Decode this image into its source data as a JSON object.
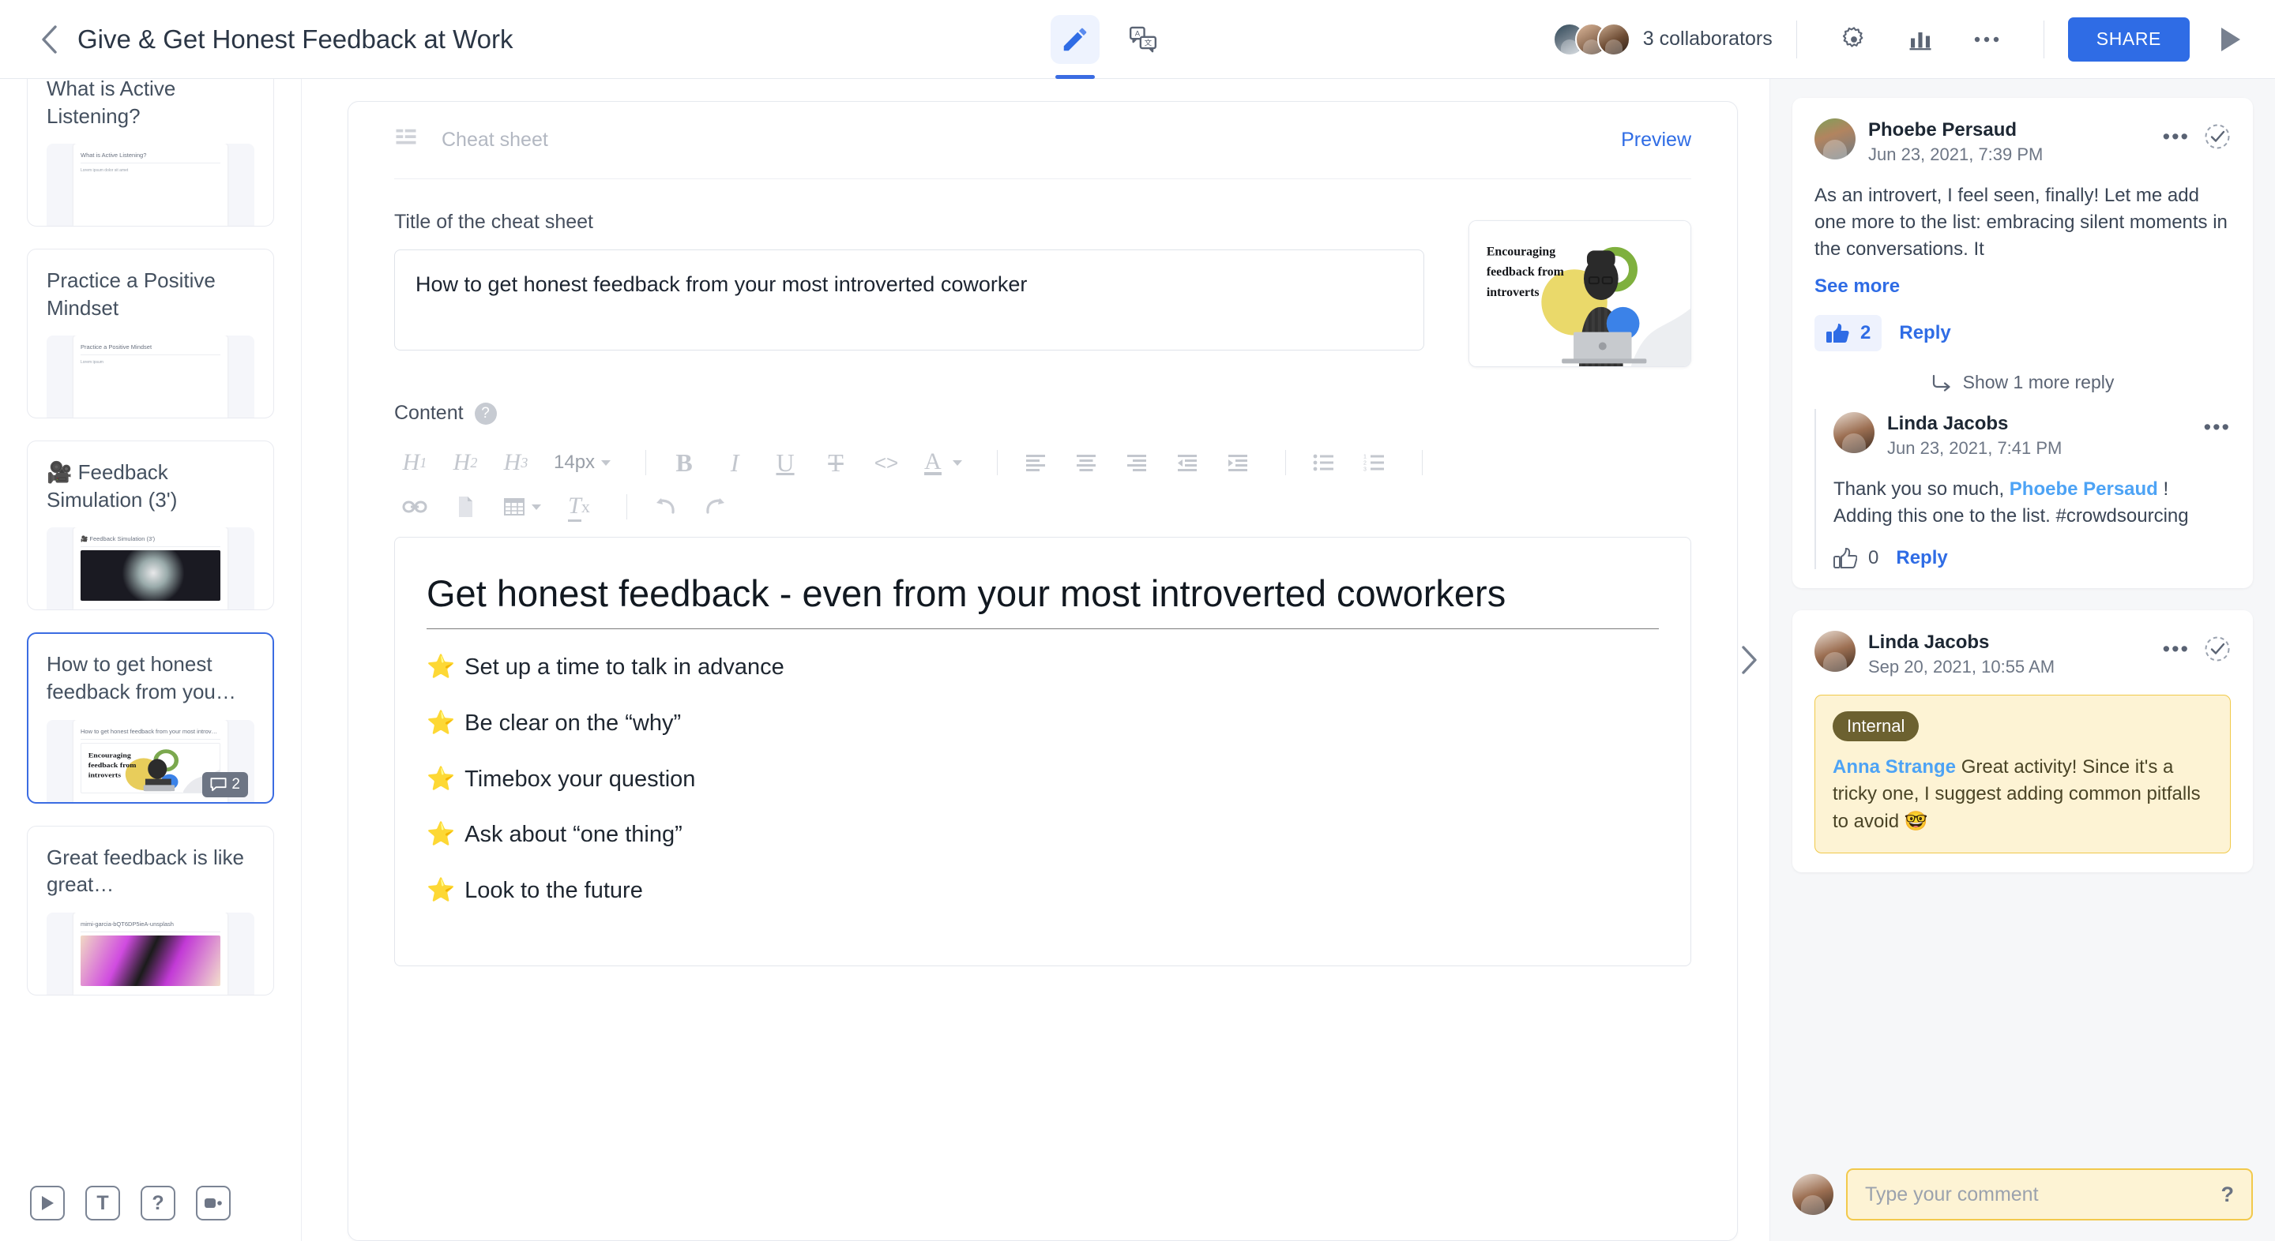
{
  "header": {
    "back_icon": "chevron-left-icon",
    "title": "Give & Get Honest Feedback at Work",
    "tabs": [
      {
        "name": "edit",
        "icon": "pencil-icon",
        "active": true
      },
      {
        "name": "translate",
        "icon": "translate-icon",
        "active": false
      }
    ],
    "collaborators_label": "3 collaborators",
    "settings_icon": "gear-icon",
    "analytics_icon": "bar-chart-icon",
    "more_icon": "ellipsis-icon",
    "share_label": "SHARE",
    "play_icon": "play-triangle-icon"
  },
  "sidebar": {
    "items": [
      {
        "title": "What is Active Listening?",
        "thumb_title": "What is Active Listening?",
        "thumb_sub": "Lorem ipsum dolor sit amet",
        "has_image": false,
        "active": false,
        "comments": null
      },
      {
        "title": "Practice a Positive Mindset",
        "thumb_title": "Practice a Positive Mindset",
        "thumb_sub": "Lorem ipsum",
        "has_image": false,
        "active": false,
        "comments": null
      },
      {
        "title": "🎥 Feedback Simulation (3')",
        "thumb_title": "🎥 Feedback Simulation (3')",
        "thumb_sub": "",
        "has_image": true,
        "image_style": "sphere",
        "active": false,
        "comments": null
      },
      {
        "title": "How to get honest feedback from you…",
        "thumb_title": "How to get honest feedback from your most introverted coworker",
        "thumb_sub": "",
        "has_image": true,
        "image_style": "cover",
        "active": true,
        "comments": "2"
      },
      {
        "title": "Great feedback is like great…",
        "thumb_title": "mimi-garcia-bQT6DP5ieA-unsplash",
        "thumb_sub": "",
        "has_image": true,
        "image_style": "purple",
        "active": false,
        "comments": null
      }
    ],
    "tools": [
      {
        "name": "play-tool",
        "icon": "play-icon",
        "label": "▶"
      },
      {
        "name": "text-tool",
        "icon": "text-icon",
        "label": "T"
      },
      {
        "name": "quiz-tool",
        "icon": "question-icon",
        "label": "?"
      },
      {
        "name": "video-tool",
        "icon": "video-camera-icon",
        "label": ""
      }
    ],
    "comment_badge_icon": "comment-bubble-icon"
  },
  "main": {
    "block_icon": "text-layout-icon",
    "block_label": "Cheat sheet",
    "preview_label": "Preview",
    "title_field_label": "Title of the cheat sheet",
    "title_value": "How to get honest feedback from your most introverted coworker",
    "cover": {
      "headline_line1": "Encouraging",
      "headline_line2": "feedback from",
      "headline_line3": "introverts"
    },
    "content_label": "Content",
    "content_help_icon": "question-circle-icon",
    "toolbar_row1": [
      {
        "name": "heading-1-button",
        "label": "H",
        "sub": "1",
        "type": "heading"
      },
      {
        "name": "heading-2-button",
        "label": "H",
        "sub": "2",
        "type": "heading"
      },
      {
        "name": "heading-3-button",
        "label": "H",
        "sub": "3",
        "type": "heading"
      },
      {
        "name": "font-size-select",
        "label": "14px",
        "type": "select"
      },
      {
        "name": "separator-1",
        "type": "sep"
      },
      {
        "name": "bold-button",
        "label": "B",
        "type": "bold"
      },
      {
        "name": "italic-button",
        "label": "I",
        "type": "italic"
      },
      {
        "name": "underline-button",
        "label": "U",
        "type": "underline"
      },
      {
        "name": "strikethrough-button",
        "label": "T",
        "type": "strike"
      },
      {
        "name": "code-button",
        "label": "<>",
        "type": "code"
      },
      {
        "name": "text-color-button",
        "label": "A",
        "type": "color"
      },
      {
        "name": "separator-2",
        "type": "sep"
      },
      {
        "name": "align-left-button",
        "type": "align-left"
      },
      {
        "name": "align-center-button",
        "type": "align-center"
      },
      {
        "name": "align-right-button",
        "type": "align-right"
      },
      {
        "name": "outdent-button",
        "type": "outdent"
      },
      {
        "name": "indent-button",
        "type": "indent"
      },
      {
        "name": "separator-3",
        "type": "sep"
      },
      {
        "name": "bullet-list-button",
        "type": "ul"
      },
      {
        "name": "numbered-list-button",
        "type": "ol"
      },
      {
        "name": "separator-4",
        "type": "sep"
      }
    ],
    "toolbar_row2": [
      {
        "name": "link-button",
        "type": "link"
      },
      {
        "name": "insert-file-button",
        "type": "file"
      },
      {
        "name": "insert-table-button",
        "type": "table"
      },
      {
        "name": "clear-format-button",
        "type": "clear"
      },
      {
        "name": "separator-5",
        "type": "sep"
      },
      {
        "name": "undo-button",
        "type": "undo"
      },
      {
        "name": "redo-button",
        "type": "redo"
      }
    ],
    "document": {
      "heading": "Get honest feedback - even from your most introverted coworkers",
      "bullets": [
        {
          "emoji": "⭐",
          "text": "Set up a time to talk in advance"
        },
        {
          "emoji": "⭐",
          "text": "Be clear on the “why”"
        },
        {
          "emoji": "⭐",
          "text": "Timebox your question"
        },
        {
          "emoji": "⭐",
          "text": "Ask about “one thing”"
        },
        {
          "emoji": "⭐",
          "text": "Look to the future"
        }
      ]
    },
    "collapse_icon": "chevron-right-icon"
  },
  "comments": {
    "threads": [
      {
        "author": "Phoebe Persaud",
        "timestamp": "Jun 23, 2021, 7:39 PM",
        "body": "As an introvert, I feel seen, finally! Let me add one more to the list: embracing silent moments in the conversations. It",
        "see_more_label": "See more",
        "like_count": "2",
        "reply_label": "Reply",
        "more_icon": "ellipsis-icon",
        "resolve_icon": "check-circle-icon",
        "like_icon": "thumbs-up-icon",
        "show_more_label": "Show 1 more reply",
        "show_more_icon": "reply-arrow-icon",
        "reply": {
          "author": "Linda Jacobs",
          "timestamp": "Jun 23, 2021, 7:41 PM",
          "body_prefix": "Thank you so much, ",
          "mention": "Phoebe Persaud",
          "body_suffix": " ! Adding this one to the list. #crowdsourcing",
          "like_count": "0",
          "reply_label": "Reply",
          "more_icon": "ellipsis-icon",
          "like_icon": "thumbs-up-outline-icon"
        }
      },
      {
        "author": "Linda Jacobs",
        "timestamp": "Sep 20, 2021, 10:55 AM",
        "more_icon": "ellipsis-icon",
        "resolve_icon": "check-circle-icon",
        "internal_badge": "Internal",
        "mention": "Anna Strange",
        "internal_text": " Great activity! Since it's a tricky one, I suggest adding common pitfalls to avoid 🤓"
      }
    ],
    "composer": {
      "placeholder": "Type your comment",
      "help_icon": "question-mark-icon",
      "help_label": "?"
    }
  },
  "colors": {
    "accent": "#2f6ce5",
    "accent_soft": "#eef2fd",
    "internal_bg": "#fdf3d4",
    "internal_border": "#f0c94a",
    "internal_badge": "#6c6130",
    "mention": "#4da3f5",
    "panel_bg": "#f6f7f9",
    "text": "#33404d",
    "muted": "#b3b8c2"
  }
}
